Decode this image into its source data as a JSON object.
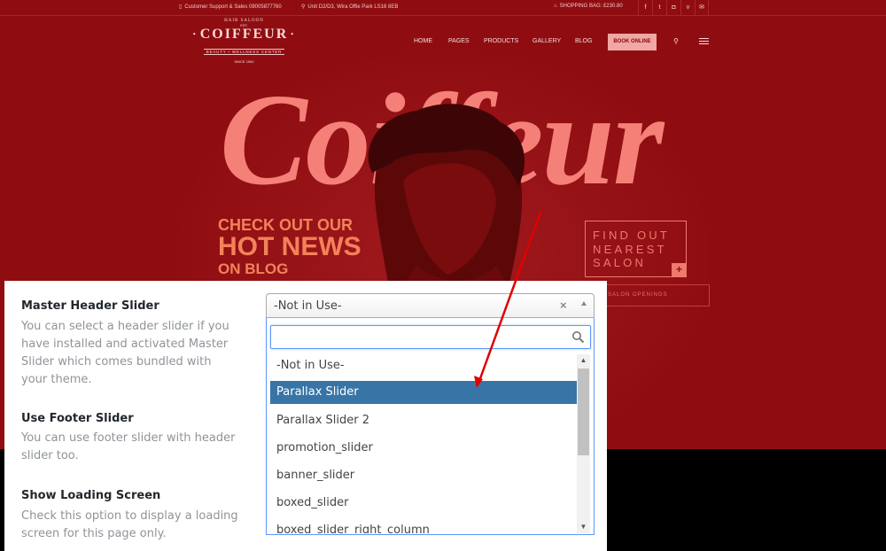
{
  "site": {
    "topbar": {
      "support": "Customer Support & Sales 08005877760",
      "address": "Unit D2/D3, Wira Offie Park LS16 8EB",
      "bag": "SHOPPING BAG: £230.80",
      "social": [
        "f",
        "t",
        "ig",
        "v",
        "mail"
      ]
    },
    "logo": {
      "top": "HAIR SALOON",
      "est": "EST.",
      "name": "COIFFEUR",
      "sub": "BEAUTY • WELLNESS CENTER",
      "since": "SINCE 1962"
    },
    "nav": {
      "items": [
        "HOME",
        "PAGES",
        "PRODUCTS",
        "GALLERY",
        "BLOG"
      ],
      "book": "BOOK ONLINE"
    },
    "hero": {
      "title": "Coiffeur",
      "promo_1": "CHECK OUT OUR",
      "promo_2": "HOT NEWS",
      "promo_3": "ON BLOG",
      "find_1": "FIND OUT",
      "find_2": "NEAREST",
      "find_3": "SALON",
      "find_plus": "+",
      "openings": "SALON OPENINGS"
    }
  },
  "panel": {
    "options": [
      {
        "title": "Master Header Slider",
        "description": "You can select a header slider if you have installed and activated Master Slider which comes bundled with your theme."
      },
      {
        "title": "Use Footer Slider",
        "description": "You can use footer slider with header slider too."
      },
      {
        "title": "Show Loading Screen",
        "description": "Check this option to display a loading screen for this page only."
      }
    ],
    "select": {
      "value": "-Not in Use-",
      "clear": "×",
      "search_value": "",
      "options": [
        "-Not in Use-",
        "Parallax Slider",
        "Parallax Slider 2",
        "promotion_slider",
        "banner_slider",
        "boxed_slider",
        "boxed_slider_right_column"
      ],
      "highlighted_index": 1
    }
  },
  "colors": {
    "site_bg": "#8f0d11",
    "hero_title": "#f58078",
    "promo": "#f3825a",
    "highlight": "#3875a6",
    "pointer": "#e00000"
  }
}
